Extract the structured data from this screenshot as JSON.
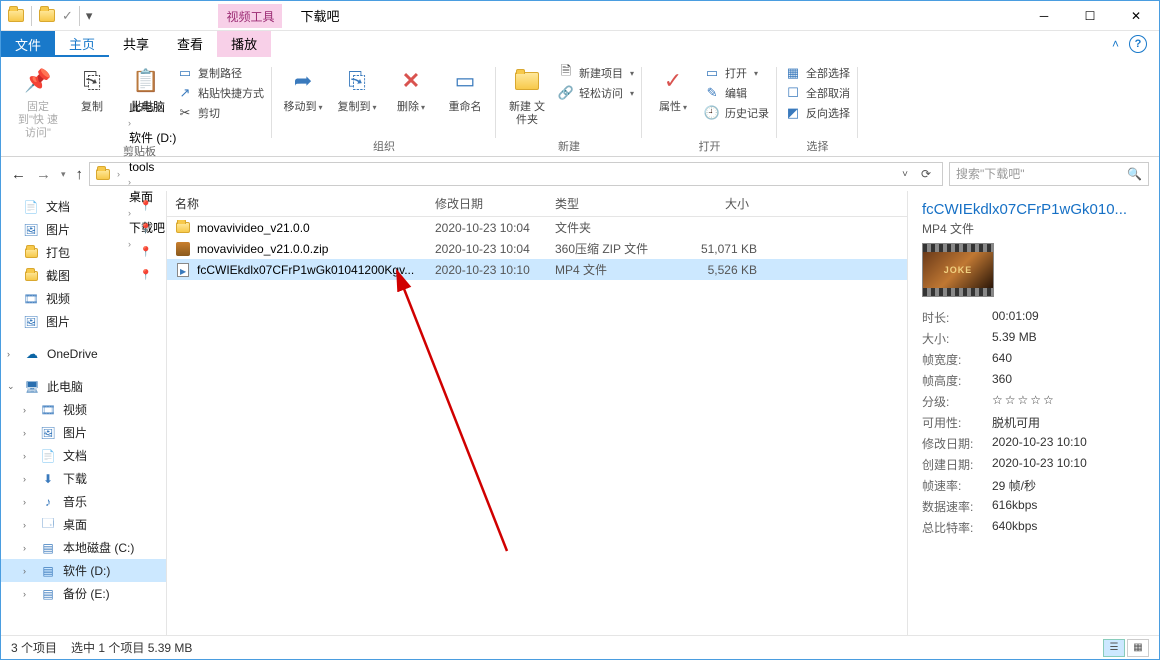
{
  "title": "下载吧",
  "context_tab": "视频工具",
  "tabs": {
    "file": "文件",
    "home": "主页",
    "share": "共享",
    "view": "查看",
    "play": "播放"
  },
  "ribbon": {
    "clipboard": {
      "pin": "固定到\"快\n速访问\"",
      "copy": "复制",
      "paste": "粘贴",
      "copy_path": "复制路径",
      "paste_shortcut": "粘贴快捷方式",
      "cut": "剪切",
      "label": "剪贴板"
    },
    "organize": {
      "move": "移动到",
      "copy_to": "复制到",
      "delete": "删除",
      "rename": "重命名",
      "label": "组织"
    },
    "new": {
      "folder": "新建\n文件夹",
      "item": "新建项目",
      "easy": "轻松访问",
      "label": "新建"
    },
    "open": {
      "props": "属性",
      "open": "打开",
      "edit": "编辑",
      "history": "历史记录",
      "label": "打开"
    },
    "select": {
      "all": "全部选择",
      "none": "全部取消",
      "invert": "反向选择",
      "label": "选择"
    }
  },
  "breadcrumbs": [
    "此电脑",
    "软件 (D:)",
    "tools",
    "桌面",
    "下载吧"
  ],
  "search_placeholder": "搜索\"下载吧\"",
  "nav": {
    "quick": [
      {
        "label": "文档",
        "icon": "doc",
        "pin": true
      },
      {
        "label": "图片",
        "icon": "pic",
        "pin": true
      },
      {
        "label": "打包",
        "icon": "folder",
        "pin": true
      },
      {
        "label": "截图",
        "icon": "folder",
        "pin": true
      },
      {
        "label": "视频",
        "icon": "vid"
      },
      {
        "label": "图片",
        "icon": "pic"
      }
    ],
    "onedrive": "OneDrive",
    "thispc": "此电脑",
    "pc_children": [
      {
        "label": "视频",
        "icon": "vid"
      },
      {
        "label": "图片",
        "icon": "pic"
      },
      {
        "label": "文档",
        "icon": "doc"
      },
      {
        "label": "下载",
        "icon": "dl"
      },
      {
        "label": "音乐",
        "icon": "music"
      },
      {
        "label": "桌面",
        "icon": "desk"
      },
      {
        "label": "本地磁盘 (C:)",
        "icon": "disk"
      },
      {
        "label": "软件 (D:)",
        "icon": "disk",
        "selected": true
      },
      {
        "label": "备份 (E:)",
        "icon": "disk"
      }
    ]
  },
  "columns": {
    "name": "名称",
    "date": "修改日期",
    "type": "类型",
    "size": "大小"
  },
  "files": [
    {
      "name": "movavivideo_v21.0.0",
      "date": "2020-10-23 10:04",
      "type": "文件夹",
      "size": "",
      "icon": "folder"
    },
    {
      "name": "movavivideo_v21.0.0.zip",
      "date": "2020-10-23 10:04",
      "type": "360压缩 ZIP 文件",
      "size": "51,071 KB",
      "icon": "zip"
    },
    {
      "name": "fcCWIEkdlx07CFrP1wGk01041200Kgv...",
      "date": "2020-10-23 10:10",
      "type": "MP4 文件",
      "size": "5,526 KB",
      "icon": "mp4",
      "selected": true
    }
  ],
  "details": {
    "title": "fcCWIEkdlx07CFrP1wGk010...",
    "type": "MP4 文件",
    "thumb_text": "JOKE",
    "props": [
      {
        "k": "时长:",
        "v": "00:01:09"
      },
      {
        "k": "大小:",
        "v": "5.39 MB"
      },
      {
        "k": "帧宽度:",
        "v": "640"
      },
      {
        "k": "帧高度:",
        "v": "360"
      },
      {
        "k": "分级:",
        "v": "☆☆☆☆☆",
        "stars": true
      },
      {
        "k": "可用性:",
        "v": "脱机可用"
      },
      {
        "k": "修改日期:",
        "v": "2020-10-23 10:10"
      },
      {
        "k": "创建日期:",
        "v": "2020-10-23 10:10"
      },
      {
        "k": "帧速率:",
        "v": "29 帧/秒"
      },
      {
        "k": "数据速率:",
        "v": "616kbps"
      },
      {
        "k": "总比特率:",
        "v": "640kbps"
      }
    ]
  },
  "status": {
    "count": "3 个项目",
    "selected": "选中 1 个项目",
    "size": "5.39 MB"
  }
}
